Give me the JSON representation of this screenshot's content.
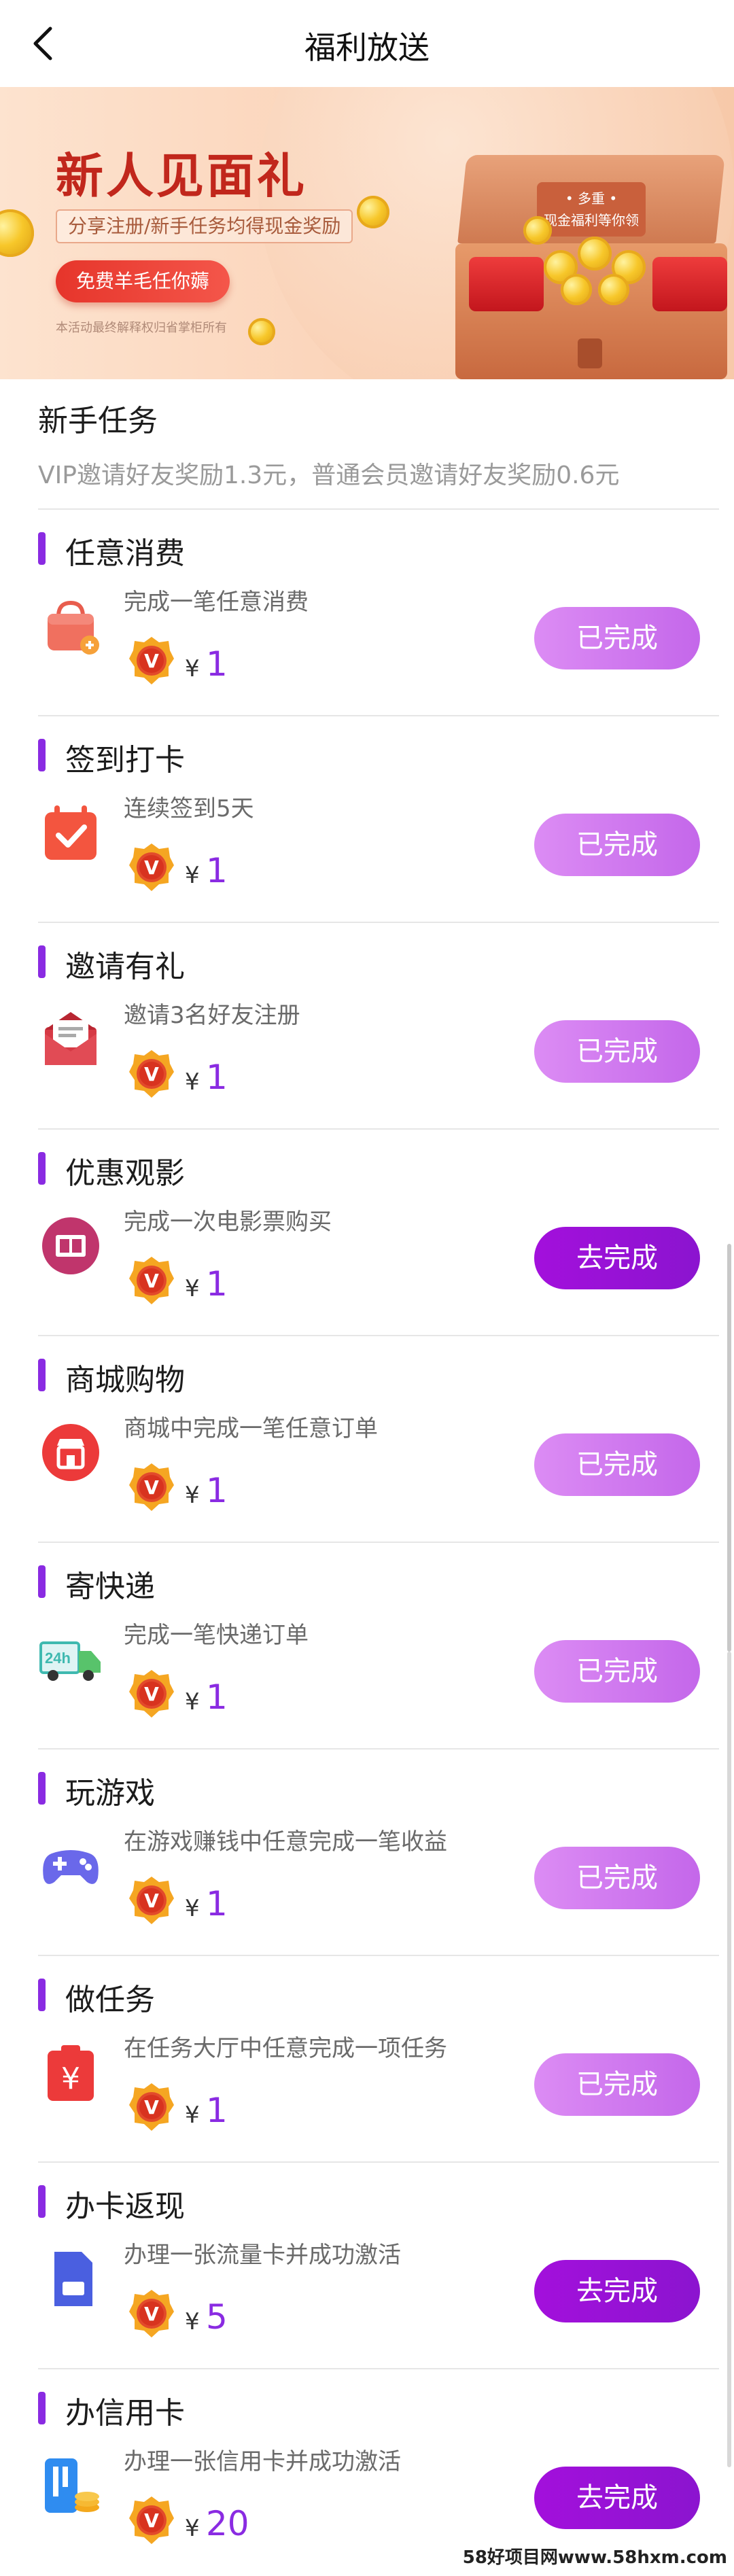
{
  "header": {
    "title": "福利放送"
  },
  "banner": {
    "headline": "新人见面礼",
    "subtitle": "分享注册/新手任务均得现金奖励",
    "cta": "免费羊毛任你薅",
    "fine_print": "本活动最终解释权归省掌柜所有",
    "chest_tag_line1": "• 多重 •",
    "chest_tag_line2": "现金福利等你领"
  },
  "section": {
    "title": "新手任务",
    "subtitle": "VIP邀请好友奖励1.3元，普通会员邀请好友奖励0.6元"
  },
  "currency_symbol": "¥",
  "tasks": [
    {
      "name": "任意消费",
      "desc": "完成一笔任意消费",
      "amount": "1",
      "button": "已完成",
      "status": "done",
      "icon": "shopping-bag-icon"
    },
    {
      "name": "签到打卡",
      "desc": "连续签到5天",
      "amount": "1",
      "button": "已完成",
      "status": "done",
      "icon": "calendar-check-icon"
    },
    {
      "name": "邀请有礼",
      "desc": "邀请3名好友注册",
      "amount": "1",
      "button": "已完成",
      "status": "done",
      "icon": "envelope-icon"
    },
    {
      "name": "优惠观影",
      "desc": "完成一次电影票购买",
      "amount": "1",
      "button": "去完成",
      "status": "todo",
      "icon": "film-icon"
    },
    {
      "name": "商城购物",
      "desc": "商城中完成一笔任意订单",
      "amount": "1",
      "button": "已完成",
      "status": "done",
      "icon": "store-icon"
    },
    {
      "name": "寄快递",
      "desc": "完成一笔快递订单",
      "amount": "1",
      "button": "已完成",
      "status": "done",
      "icon": "delivery-truck-icon"
    },
    {
      "name": "玩游戏",
      "desc": "在游戏赚钱中任意完成一笔收益",
      "amount": "1",
      "button": "已完成",
      "status": "done",
      "icon": "gamepad-icon"
    },
    {
      "name": "做任务",
      "desc": "在任务大厅中任意完成一项任务",
      "amount": "1",
      "button": "已完成",
      "status": "done",
      "icon": "task-clipboard-icon"
    },
    {
      "name": "办卡返现",
      "desc": "办理一张流量卡并成功激活",
      "amount": "5",
      "button": "去完成",
      "status": "todo",
      "icon": "sim-card-icon"
    },
    {
      "name": "办信用卡",
      "desc": "办理一张信用卡并成功激活",
      "amount": "20",
      "button": "去完成",
      "status": "todo",
      "icon": "credit-card-icon"
    }
  ],
  "watermark": "58好项目网www.58hxm.com",
  "colors": {
    "accent": "#8a2be2",
    "done_button": "#c467ea",
    "todo_button": "#9b12d8"
  }
}
